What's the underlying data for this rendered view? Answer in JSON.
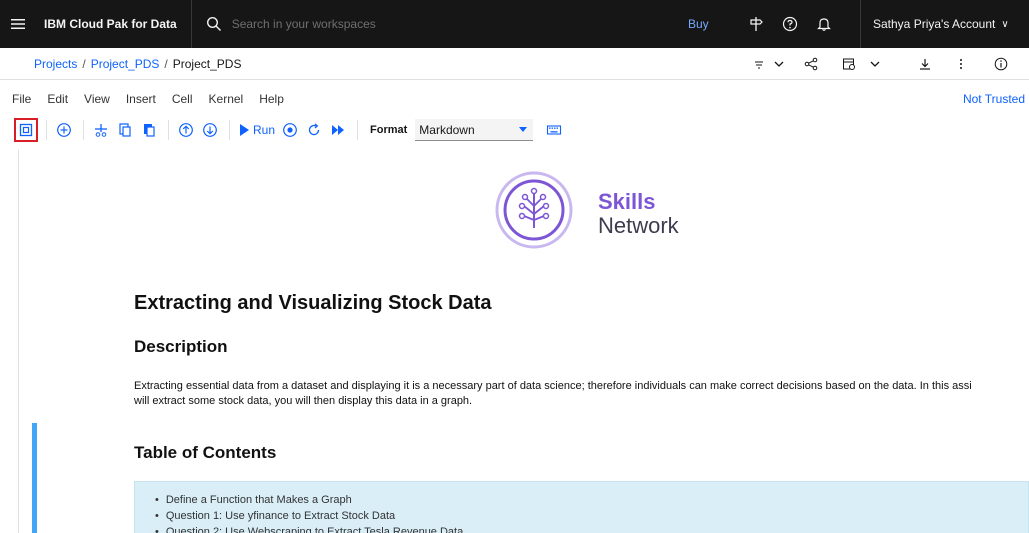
{
  "header": {
    "brand": "IBM Cloud Pak for Data",
    "search_placeholder": "Search in your workspaces",
    "buy_label": "Buy",
    "account_label": "Sathya Priya's Account",
    "account_chevron": "∨"
  },
  "breadcrumb": {
    "items": [
      "Projects",
      "Project_PDS"
    ],
    "separator": "/",
    "current": "Project_PDS"
  },
  "menu": {
    "items": [
      "File",
      "Edit",
      "View",
      "Insert",
      "Cell",
      "Kernel",
      "Help"
    ],
    "trust_status": "Not Trusted"
  },
  "toolbar": {
    "run_label": "Run",
    "format_label": "Format",
    "format_value": "Markdown"
  },
  "notebook": {
    "logo_line1": "Skills",
    "logo_line2": "Network",
    "title": "Extracting and Visualizing Stock Data",
    "description_heading": "Description",
    "description_line1": "Extracting essential data from a dataset and displaying it is a necessary part of data science; therefore individuals can make correct decisions based on the data. In this assi",
    "description_line2": "will extract some stock data, you will then display this data in a graph.",
    "toc_heading": "Table of Contents",
    "toc_items": [
      "Define a Function that Makes a Graph",
      "Question 1: Use yfinance to Extract Stock Data",
      "Question 2: Use Webscraping to Extract Tesla Revenue Data"
    ]
  },
  "colors": {
    "header_bg": "#161616",
    "link_blue": "#0f62fe",
    "logo_purple": "#7d56d6",
    "selected_cell_border": "#42a5f5",
    "toc_bg": "#d9eef7",
    "highlight_red": "#da1e28"
  }
}
